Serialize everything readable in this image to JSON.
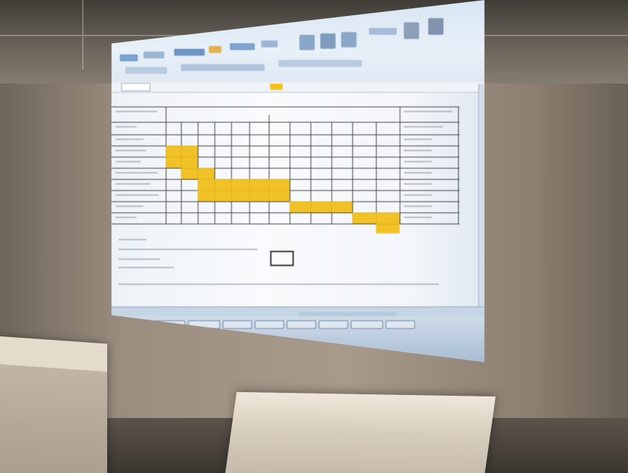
{
  "scene": {
    "description_type": "projected spreadsheet in a room",
    "colors": {
      "wall": "#a89a8b",
      "highlight_cells": "#f0bd16",
      "screen": "#f4f7fb",
      "grid_lines": "#3b3b3b"
    }
  },
  "spreadsheet": {
    "gantt_rows": 10,
    "gantt_columns": 12
  }
}
